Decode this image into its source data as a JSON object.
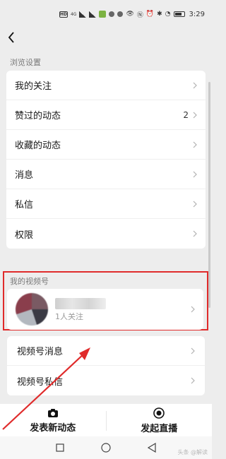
{
  "statusbar": {
    "network": "HD",
    "signal_text": "4G",
    "time": "3:29"
  },
  "settings": {
    "section_title": "浏览设置",
    "items": [
      {
        "label": "我的关注",
        "count": ""
      },
      {
        "label": "赞过的动态",
        "count": "2"
      },
      {
        "label": "收藏的动态",
        "count": ""
      },
      {
        "label": "消息",
        "count": ""
      },
      {
        "label": "私信",
        "count": ""
      },
      {
        "label": "权限",
        "count": ""
      }
    ]
  },
  "channel": {
    "section_title": "我的视频号",
    "follow_text": "1人关注",
    "items": [
      {
        "label": "视频号消息"
      },
      {
        "label": "视频号私信"
      }
    ]
  },
  "actions": {
    "post_label": "发表新动态",
    "live_label": "发起直播"
  },
  "watermark": "头条 @解读",
  "colors": {
    "highlight": "#e02b2b",
    "background": "#ededed"
  }
}
